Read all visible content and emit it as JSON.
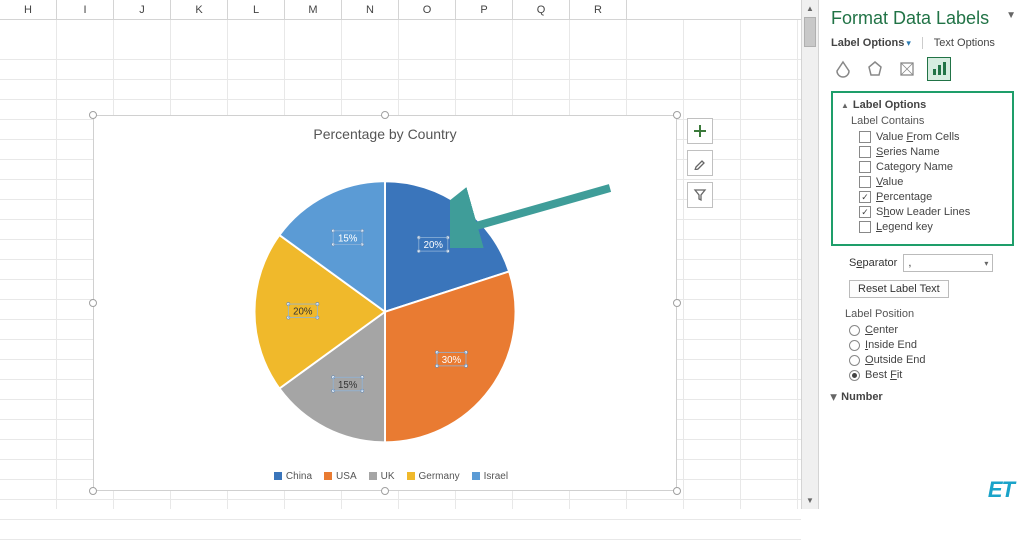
{
  "columns": [
    "H",
    "I",
    "J",
    "K",
    "L",
    "M",
    "N",
    "O",
    "P",
    "Q",
    "R"
  ],
  "chart": {
    "title": "Percentage by Country",
    "legend": [
      "China",
      "USA",
      "UK",
      "Germany",
      "Israel"
    ],
    "colors": [
      "#3a75bb",
      "#e97b32",
      "#a5a5a5",
      "#f0b92b",
      "#5b9bd5"
    ]
  },
  "chart_data": {
    "type": "pie",
    "title": "Percentage by Country",
    "categories": [
      "China",
      "USA",
      "UK",
      "Germany",
      "Israel"
    ],
    "values": [
      20,
      30,
      15,
      20,
      15
    ],
    "labels": [
      "20%",
      "30%",
      "15%",
      "20%",
      "15%"
    ],
    "colors": [
      "#3a75bb",
      "#e97b32",
      "#a5a5a5",
      "#f0b92b",
      "#5b9bd5"
    ]
  },
  "side_buttons": [
    "plus-icon",
    "brush-icon",
    "filter-icon"
  ],
  "pane": {
    "title": "Format Data Labels",
    "tab_label_options": "Label Options",
    "tab_text_options": "Text Options",
    "section_label_options": "Label Options",
    "label_contains": "Label Contains",
    "chk_value_from_cells": "Value From Cells",
    "chk_series_name": "Series Name",
    "chk_category_name": "Category Name",
    "chk_value": "Value",
    "chk_percentage": "Percentage",
    "chk_show_leader": "Show Leader Lines",
    "chk_legend_key": "Legend key",
    "separator_label": "Separator",
    "separator_value": ",",
    "reset_label": "Reset Label Text",
    "label_position": "Label Position",
    "rad_center": "Center",
    "rad_inside_end": "Inside End",
    "rad_outside_end": "Outside End",
    "rad_best_fit": "Best Fit",
    "section_number": "Number"
  },
  "logo": "ET"
}
